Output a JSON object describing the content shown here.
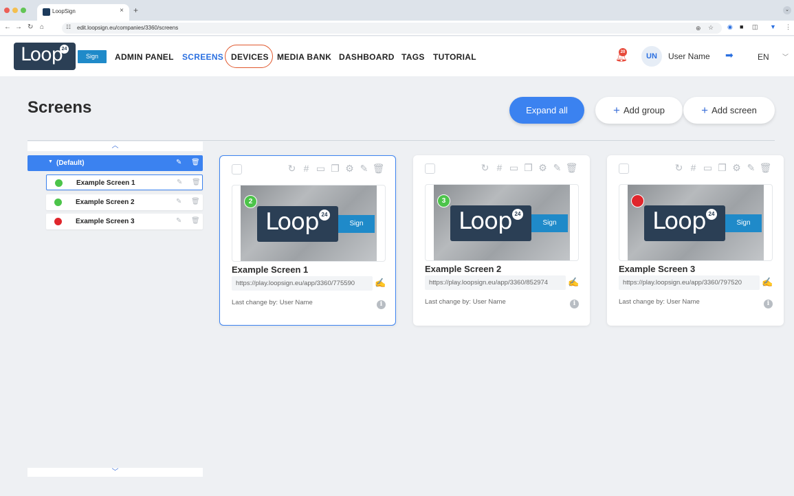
{
  "browser": {
    "tab_title": "LoopSign",
    "tab_close": "×",
    "new_tab": "+",
    "url": "edit.loopsign.eu/companies/3360/screens"
  },
  "header": {
    "logo_text": "Loop",
    "logo_badge": "24",
    "logo_sign": "Sign",
    "menu": [
      {
        "label": "ADMIN PANEL"
      },
      {
        "label": "SCREENS"
      },
      {
        "label": "DEVICES"
      },
      {
        "label": "MEDIA BANK"
      },
      {
        "label": "DASHBOARD"
      },
      {
        "label": "TAGS"
      },
      {
        "label": "TUTORIAL"
      }
    ],
    "notification_count": "20",
    "avatar_initials": "UN",
    "user_name": "User Name",
    "language": "EN"
  },
  "page": {
    "title": "Screens",
    "expand_all": "Expand all",
    "add_group": "Add group",
    "add_screen": "Add screen"
  },
  "tree": {
    "group_label": "(Default)",
    "items": [
      {
        "label": "Example Screen 1",
        "status": "green"
      },
      {
        "label": "Example Screen 2",
        "status": "green"
      },
      {
        "label": "Example Screen 3",
        "status": "red"
      }
    ]
  },
  "cards": [
    {
      "title": "Example Screen 1",
      "url": "https://play.loopsign.eu/app/3360/775590",
      "last_change": "Last change by: User Name",
      "status_label": "2",
      "status": "green"
    },
    {
      "title": "Example Screen 2",
      "url": "https://play.loopsign.eu/app/3360/852974",
      "last_change": "Last change by: User Name",
      "status_label": "3",
      "status": "green"
    },
    {
      "title": "Example Screen 3",
      "url": "https://play.loopsign.eu/app/3360/797520",
      "last_change": "Last change by: User Name",
      "status_label": "",
      "status": "red"
    }
  ],
  "colors": {
    "accent": "#3b82f0",
    "logo_bg": "#2b3f55",
    "sign_blue": "#1f8ac9",
    "status_green": "#4cc44a",
    "status_red": "#e0262c",
    "devices_highlight": "#e0572c"
  }
}
